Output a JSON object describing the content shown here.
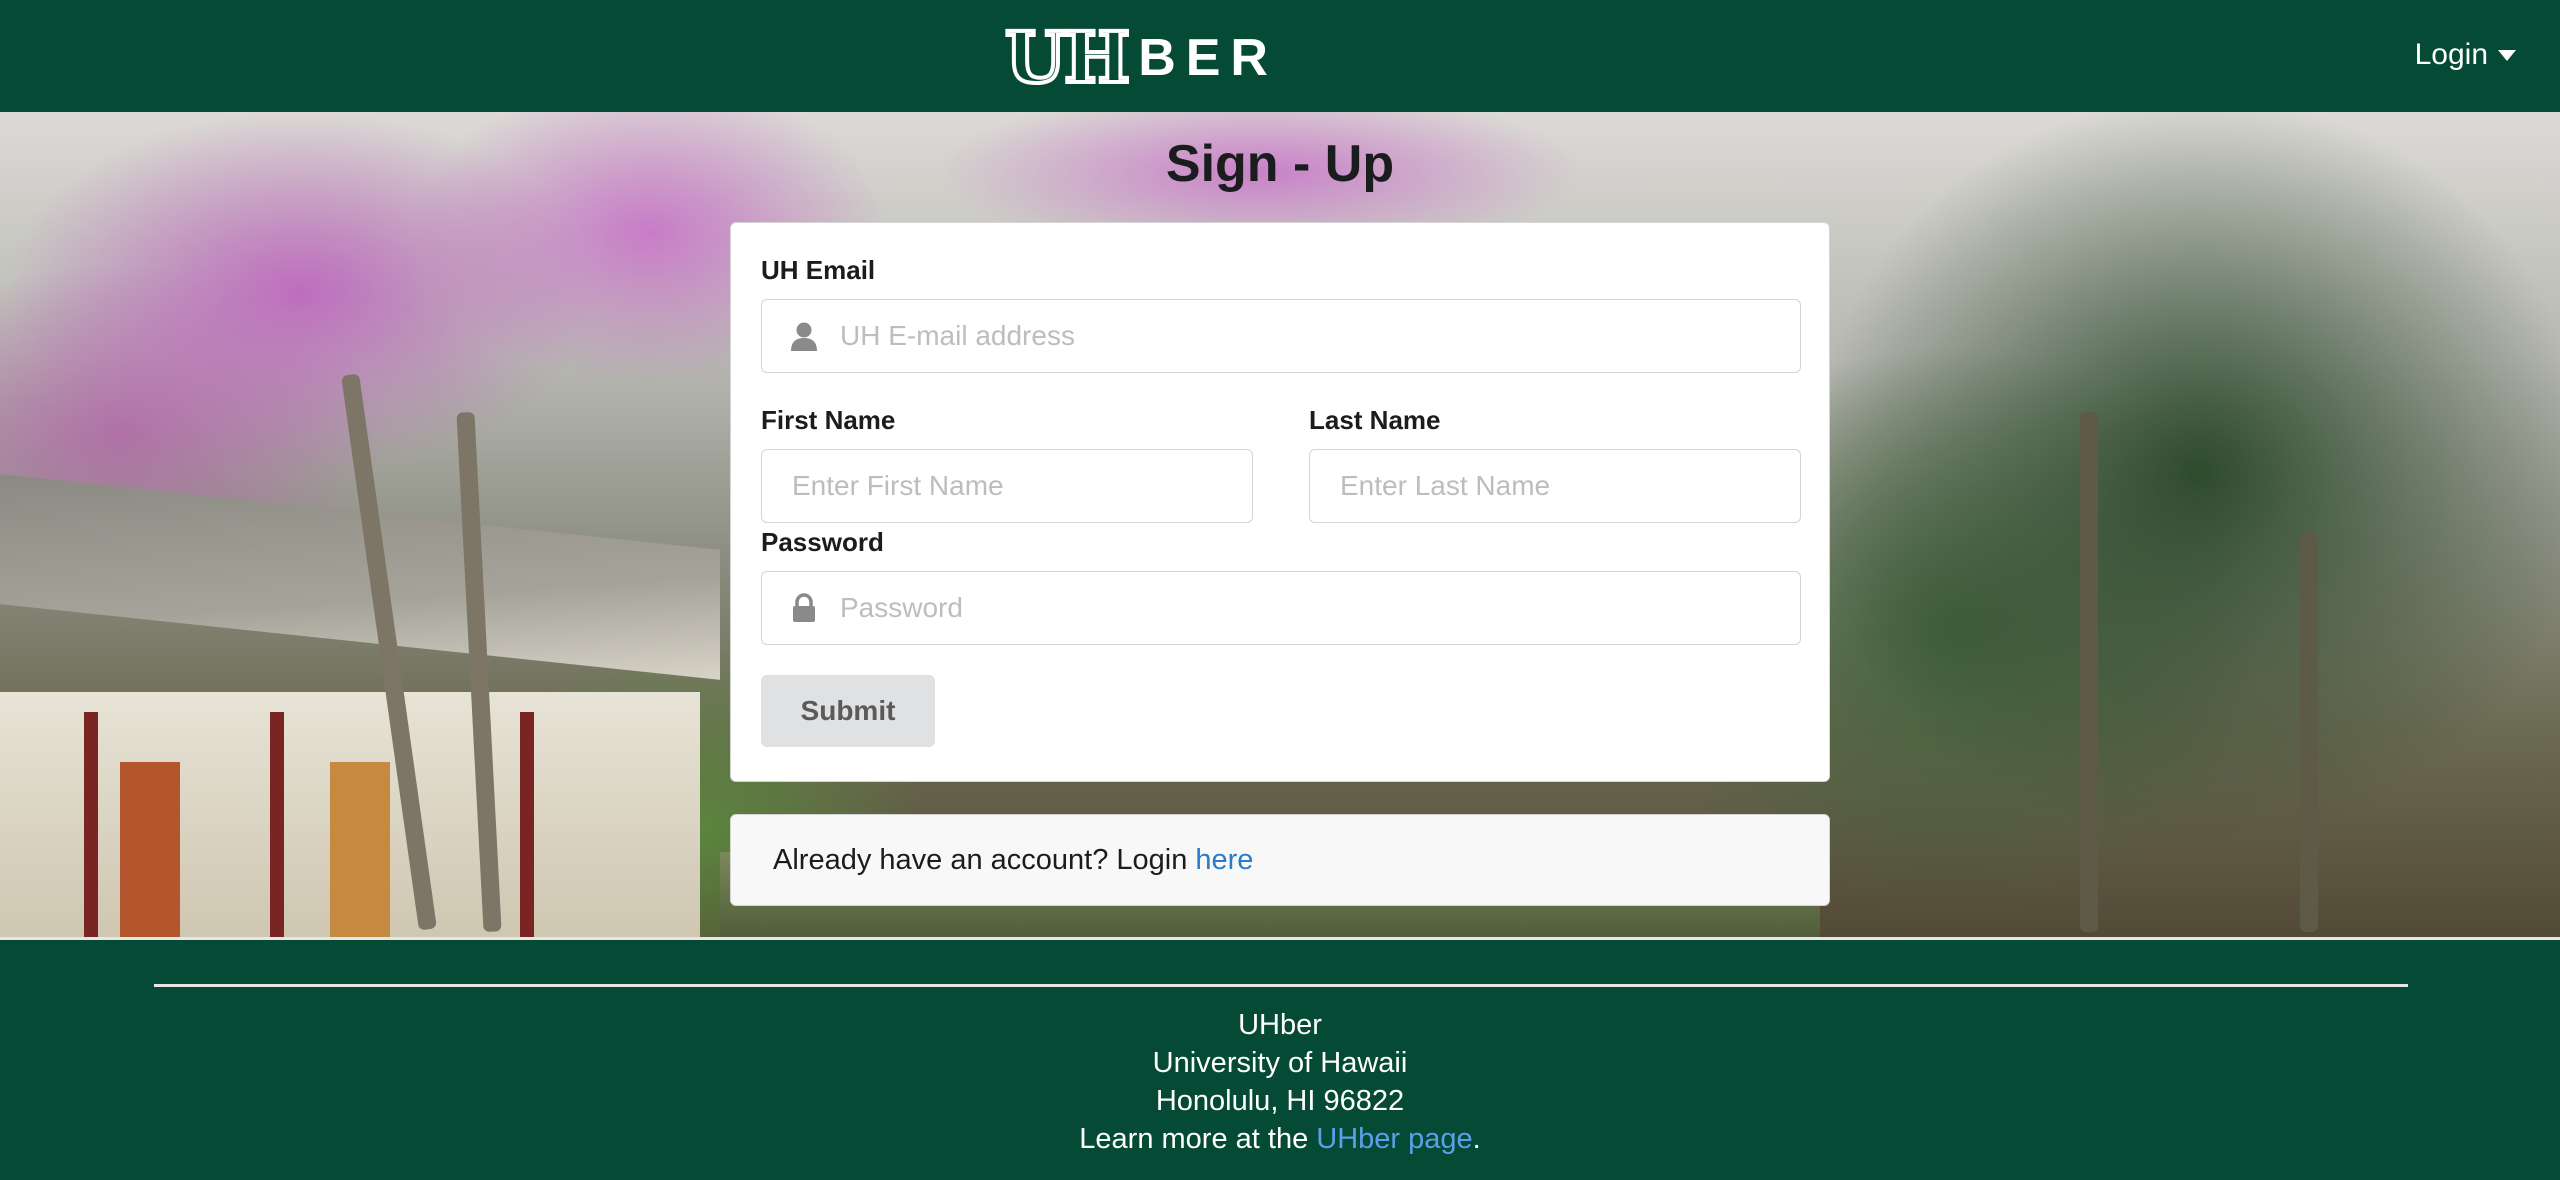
{
  "header": {
    "logo_mark": "UH",
    "logo_text": "BER",
    "login_label": "Login"
  },
  "page": {
    "title": "Sign - Up"
  },
  "form": {
    "email_label": "UH Email",
    "email_placeholder": "UH E-mail address",
    "first_name_label": "First Name",
    "first_name_placeholder": "Enter First Name",
    "last_name_label": "Last Name",
    "last_name_placeholder": "Enter Last Name",
    "password_label": "Password",
    "password_placeholder": "Password",
    "submit_label": "Submit"
  },
  "message": {
    "text": "Already have an account? Login",
    "link_text": "here"
  },
  "footer": {
    "line1": "UHber",
    "line2": "University of Hawaii",
    "line3": "Honolulu, HI 96822",
    "line4_prefix": "Learn more at the",
    "line4_link": "UHber page",
    "line4_suffix": "."
  },
  "colors": {
    "brand_green": "#044a34",
    "link_blue": "#2a7cc7",
    "footer_link": "#5aa0e6"
  },
  "icons": [
    "user-icon",
    "lock-icon",
    "caret-down-icon"
  ]
}
